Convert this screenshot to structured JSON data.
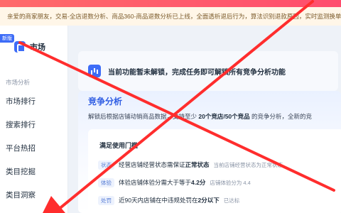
{
  "notice": {
    "text": "亲爱的商家朋友，交易-全店退数分析、商品360-商品退数分析已上线，全面透析退后行为，算法识别退款原因，实时监测换单机会"
  },
  "sidebar": {
    "badge": "新版",
    "brand": "市场",
    "section_label": "市场分析",
    "items": [
      {
        "label": "市场排行"
      },
      {
        "label": "搜索排行"
      },
      {
        "label": "平台热招"
      },
      {
        "label": "类目挖掘"
      },
      {
        "label": "类目洞察"
      }
    ]
  },
  "banner": {
    "text": "当前功能暂未解锁，完成任务即可解锁所有竞争分析功能"
  },
  "panel": {
    "title": "竞争分析",
    "desc_prefix": "解锁后根据店铺动销商品数据，支持至少",
    "desc_highlight": "20个竞店/50个竞品",
    "desc_suffix": "的竞争分析，全新的竞"
  },
  "requirements": {
    "title": "满足使用门槛",
    "rows": [
      {
        "tag": "状态",
        "main_prefix": "经营店铺经营状态需保证",
        "main_bold": "正常状态",
        "sub": "当前店铺经营状态为正常状态"
      },
      {
        "tag": "体验",
        "main_prefix": "体验店铺体验分需大于等于",
        "main_bold": "4.2分",
        "sub": "店铺体验分为 4.4"
      },
      {
        "tag": "处罚",
        "main_prefix": "近90天内店铺在中违规处罚在",
        "main_bold": "2分以下",
        "sub": "已达标"
      }
    ]
  },
  "colors": {
    "accent": "#3d6cf7",
    "annotation": "#ff2d2d"
  },
  "icons": {
    "notice": "bell-icon",
    "brand": "market-logo-icon",
    "banner": "bar-chart-icon"
  }
}
